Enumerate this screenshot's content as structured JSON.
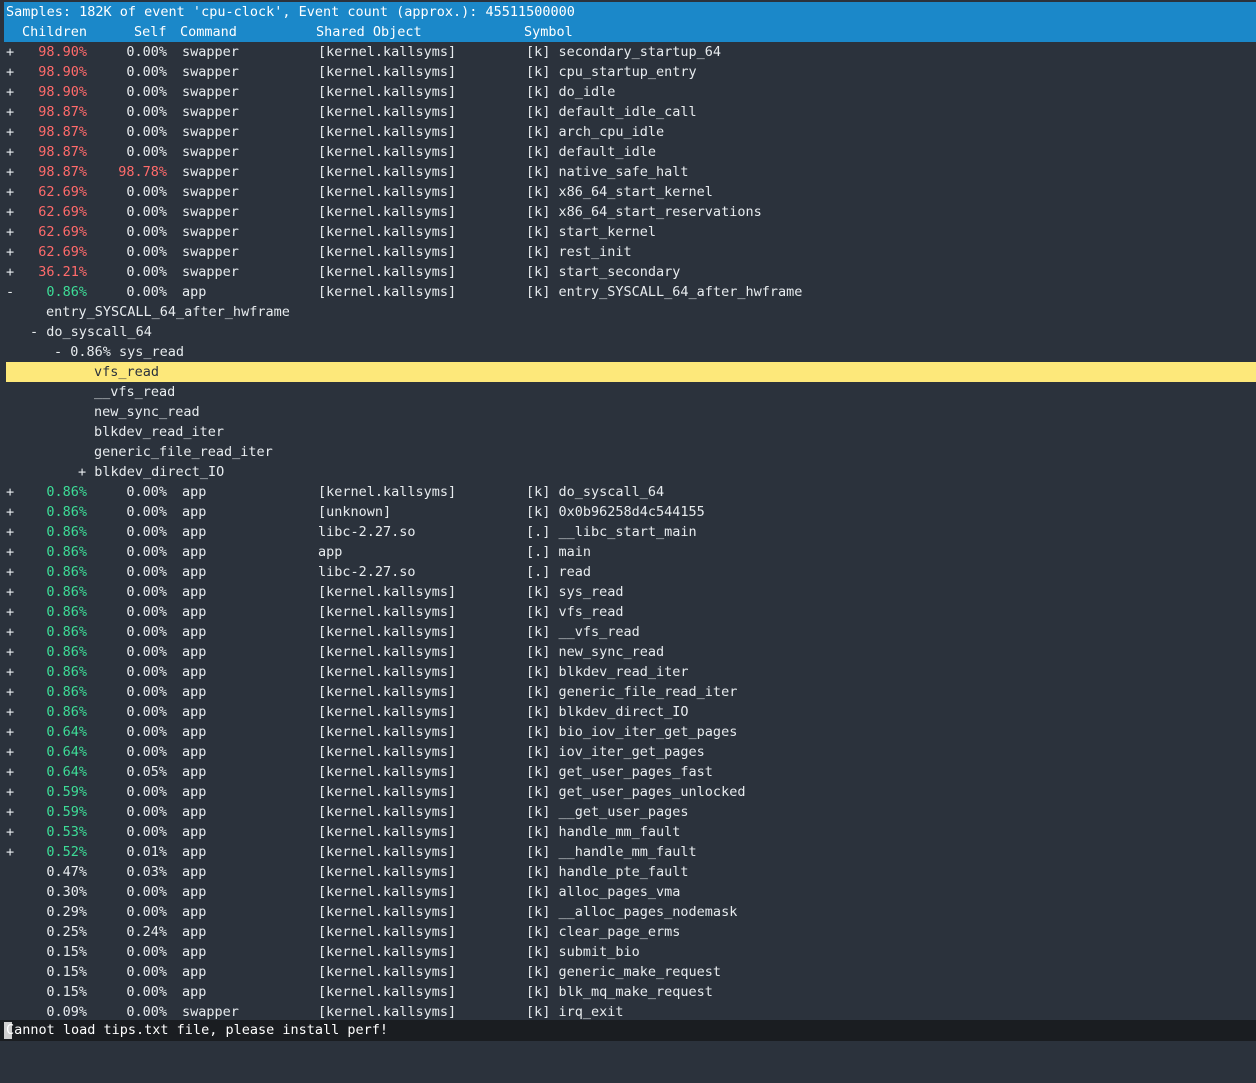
{
  "title": "Samples: 182K of event 'cpu-clock', Event count (approx.): 45511500000",
  "columns": {
    "children": "Children",
    "self": "Self",
    "command": "Command",
    "shared_object": "Shared Object",
    "symbol": "Symbol"
  },
  "rows_top": [
    {
      "toggle": "+",
      "children": "98.90%",
      "self": "0.00%",
      "command": "swapper",
      "object": "[kernel.kallsyms]",
      "symbol": "[k] secondary_startup_64",
      "heat": "hot",
      "self_heat": "plain"
    },
    {
      "toggle": "+",
      "children": "98.90%",
      "self": "0.00%",
      "command": "swapper",
      "object": "[kernel.kallsyms]",
      "symbol": "[k] cpu_startup_entry",
      "heat": "hot",
      "self_heat": "plain"
    },
    {
      "toggle": "+",
      "children": "98.90%",
      "self": "0.00%",
      "command": "swapper",
      "object": "[kernel.kallsyms]",
      "symbol": "[k] do_idle",
      "heat": "hot",
      "self_heat": "plain"
    },
    {
      "toggle": "+",
      "children": "98.87%",
      "self": "0.00%",
      "command": "swapper",
      "object": "[kernel.kallsyms]",
      "symbol": "[k] default_idle_call",
      "heat": "hot",
      "self_heat": "plain"
    },
    {
      "toggle": "+",
      "children": "98.87%",
      "self": "0.00%",
      "command": "swapper",
      "object": "[kernel.kallsyms]",
      "symbol": "[k] arch_cpu_idle",
      "heat": "hot",
      "self_heat": "plain"
    },
    {
      "toggle": "+",
      "children": "98.87%",
      "self": "0.00%",
      "command": "swapper",
      "object": "[kernel.kallsyms]",
      "symbol": "[k] default_idle",
      "heat": "hot",
      "self_heat": "plain"
    },
    {
      "toggle": "+",
      "children": "98.87%",
      "self": "98.78%",
      "command": "swapper",
      "object": "[kernel.kallsyms]",
      "symbol": "[k] native_safe_halt",
      "heat": "hot",
      "self_heat": "hot"
    },
    {
      "toggle": "+",
      "children": "62.69%",
      "self": "0.00%",
      "command": "swapper",
      "object": "[kernel.kallsyms]",
      "symbol": "[k] x86_64_start_kernel",
      "heat": "hot",
      "self_heat": "plain"
    },
    {
      "toggle": "+",
      "children": "62.69%",
      "self": "0.00%",
      "command": "swapper",
      "object": "[kernel.kallsyms]",
      "symbol": "[k] x86_64_start_reservations",
      "heat": "hot",
      "self_heat": "plain"
    },
    {
      "toggle": "+",
      "children": "62.69%",
      "self": "0.00%",
      "command": "swapper",
      "object": "[kernel.kallsyms]",
      "symbol": "[k] start_kernel",
      "heat": "hot",
      "self_heat": "plain"
    },
    {
      "toggle": "+",
      "children": "62.69%",
      "self": "0.00%",
      "command": "swapper",
      "object": "[kernel.kallsyms]",
      "symbol": "[k] rest_init",
      "heat": "hot",
      "self_heat": "plain"
    },
    {
      "toggle": "+",
      "children": "36.21%",
      "self": "0.00%",
      "command": "swapper",
      "object": "[kernel.kallsyms]",
      "symbol": "[k] start_secondary",
      "heat": "hot",
      "self_heat": "plain"
    },
    {
      "toggle": "-",
      "children": "0.86%",
      "self": "0.00%",
      "command": "app",
      "object": "[kernel.kallsyms]",
      "symbol": "[k] entry_SYSCALL_64_after_hwframe",
      "heat": "warm",
      "self_heat": "plain"
    }
  ],
  "tree": [
    {
      "text": "entry_SYSCALL_64_after_hwframe",
      "indent": 46,
      "selected": false
    },
    {
      "text": "- do_syscall_64",
      "indent": 30,
      "selected": false
    },
    {
      "text": "- 0.86% sys_read",
      "indent": 54,
      "selected": false
    },
    {
      "text": "vfs_read",
      "indent": 94,
      "selected": true
    },
    {
      "text": "__vfs_read",
      "indent": 94,
      "selected": false
    },
    {
      "text": "new_sync_read",
      "indent": 94,
      "selected": false
    },
    {
      "text": "blkdev_read_iter",
      "indent": 94,
      "selected": false
    },
    {
      "text": "generic_file_read_iter",
      "indent": 94,
      "selected": false
    },
    {
      "text": "+ blkdev_direct_IO",
      "indent": 78,
      "selected": false
    }
  ],
  "rows_bottom": [
    {
      "toggle": "+",
      "children": "0.86%",
      "self": "0.00%",
      "command": "app",
      "object": "[kernel.kallsyms]",
      "symbol": "[k] do_syscall_64",
      "heat": "warm",
      "self_heat": "plain"
    },
    {
      "toggle": "+",
      "children": "0.86%",
      "self": "0.00%",
      "command": "app",
      "object": "[unknown]",
      "symbol": "[k] 0x0b96258d4c544155",
      "heat": "warm",
      "self_heat": "plain"
    },
    {
      "toggle": "+",
      "children": "0.86%",
      "self": "0.00%",
      "command": "app",
      "object": "libc-2.27.so",
      "symbol": "[.] __libc_start_main",
      "heat": "warm",
      "self_heat": "plain"
    },
    {
      "toggle": "+",
      "children": "0.86%",
      "self": "0.00%",
      "command": "app",
      "object": "app",
      "symbol": "[.] main",
      "heat": "warm",
      "self_heat": "plain"
    },
    {
      "toggle": "+",
      "children": "0.86%",
      "self": "0.00%",
      "command": "app",
      "object": "libc-2.27.so",
      "symbol": "[.] read",
      "heat": "warm",
      "self_heat": "plain"
    },
    {
      "toggle": "+",
      "children": "0.86%",
      "self": "0.00%",
      "command": "app",
      "object": "[kernel.kallsyms]",
      "symbol": "[k] sys_read",
      "heat": "warm",
      "self_heat": "plain"
    },
    {
      "toggle": "+",
      "children": "0.86%",
      "self": "0.00%",
      "command": "app",
      "object": "[kernel.kallsyms]",
      "symbol": "[k] vfs_read",
      "heat": "warm",
      "self_heat": "plain"
    },
    {
      "toggle": "+",
      "children": "0.86%",
      "self": "0.00%",
      "command": "app",
      "object": "[kernel.kallsyms]",
      "symbol": "[k] __vfs_read",
      "heat": "warm",
      "self_heat": "plain"
    },
    {
      "toggle": "+",
      "children": "0.86%",
      "self": "0.00%",
      "command": "app",
      "object": "[kernel.kallsyms]",
      "symbol": "[k] new_sync_read",
      "heat": "warm",
      "self_heat": "plain"
    },
    {
      "toggle": "+",
      "children": "0.86%",
      "self": "0.00%",
      "command": "app",
      "object": "[kernel.kallsyms]",
      "symbol": "[k] blkdev_read_iter",
      "heat": "warm",
      "self_heat": "plain"
    },
    {
      "toggle": "+",
      "children": "0.86%",
      "self": "0.00%",
      "command": "app",
      "object": "[kernel.kallsyms]",
      "symbol": "[k] generic_file_read_iter",
      "heat": "warm",
      "self_heat": "plain"
    },
    {
      "toggle": "+",
      "children": "0.86%",
      "self": "0.00%",
      "command": "app",
      "object": "[kernel.kallsyms]",
      "symbol": "[k] blkdev_direct_IO",
      "heat": "warm",
      "self_heat": "plain"
    },
    {
      "toggle": "+",
      "children": "0.64%",
      "self": "0.00%",
      "command": "app",
      "object": "[kernel.kallsyms]",
      "symbol": "[k] bio_iov_iter_get_pages",
      "heat": "warm",
      "self_heat": "plain"
    },
    {
      "toggle": "+",
      "children": "0.64%",
      "self": "0.00%",
      "command": "app",
      "object": "[kernel.kallsyms]",
      "symbol": "[k] iov_iter_get_pages",
      "heat": "warm",
      "self_heat": "plain"
    },
    {
      "toggle": "+",
      "children": "0.64%",
      "self": "0.05%",
      "command": "app",
      "object": "[kernel.kallsyms]",
      "symbol": "[k] get_user_pages_fast",
      "heat": "warm",
      "self_heat": "plain"
    },
    {
      "toggle": "+",
      "children": "0.59%",
      "self": "0.00%",
      "command": "app",
      "object": "[kernel.kallsyms]",
      "symbol": "[k] get_user_pages_unlocked",
      "heat": "warm",
      "self_heat": "plain"
    },
    {
      "toggle": "+",
      "children": "0.59%",
      "self": "0.00%",
      "command": "app",
      "object": "[kernel.kallsyms]",
      "symbol": "[k] __get_user_pages",
      "heat": "warm",
      "self_heat": "plain"
    },
    {
      "toggle": "+",
      "children": "0.53%",
      "self": "0.00%",
      "command": "app",
      "object": "[kernel.kallsyms]",
      "symbol": "[k] handle_mm_fault",
      "heat": "warm",
      "self_heat": "plain"
    },
    {
      "toggle": "+",
      "children": "0.52%",
      "self": "0.01%",
      "command": "app",
      "object": "[kernel.kallsyms]",
      "symbol": "[k] __handle_mm_fault",
      "heat": "warm",
      "self_heat": "plain"
    },
    {
      "toggle": "",
      "children": "0.47%",
      "self": "0.03%",
      "command": "app",
      "object": "[kernel.kallsyms]",
      "symbol": "[k] handle_pte_fault",
      "heat": "plain",
      "self_heat": "plain"
    },
    {
      "toggle": "",
      "children": "0.30%",
      "self": "0.00%",
      "command": "app",
      "object": "[kernel.kallsyms]",
      "symbol": "[k] alloc_pages_vma",
      "heat": "plain",
      "self_heat": "plain"
    },
    {
      "toggle": "",
      "children": "0.29%",
      "self": "0.00%",
      "command": "app",
      "object": "[kernel.kallsyms]",
      "symbol": "[k] __alloc_pages_nodemask",
      "heat": "plain",
      "self_heat": "plain"
    },
    {
      "toggle": "",
      "children": "0.25%",
      "self": "0.24%",
      "command": "app",
      "object": "[kernel.kallsyms]",
      "symbol": "[k] clear_page_erms",
      "heat": "plain",
      "self_heat": "plain"
    },
    {
      "toggle": "",
      "children": "0.15%",
      "self": "0.00%",
      "command": "app",
      "object": "[kernel.kallsyms]",
      "symbol": "[k] submit_bio",
      "heat": "plain",
      "self_heat": "plain"
    },
    {
      "toggle": "",
      "children": "0.15%",
      "self": "0.00%",
      "command": "app",
      "object": "[kernel.kallsyms]",
      "symbol": "[k] generic_make_request",
      "heat": "plain",
      "self_heat": "plain"
    },
    {
      "toggle": "",
      "children": "0.15%",
      "self": "0.00%",
      "command": "app",
      "object": "[kernel.kallsyms]",
      "symbol": "[k] blk_mq_make_request",
      "heat": "plain",
      "self_heat": "plain"
    },
    {
      "toggle": "",
      "children": "0.09%",
      "self": "0.00%",
      "command": "swapper",
      "object": "[kernel.kallsyms]",
      "symbol": "[k] irq_exit",
      "heat": "plain",
      "self_heat": "plain"
    }
  ],
  "status": "Cannot load tips.txt file, please install perf!",
  "colors": {
    "background": "#2b323c",
    "header": "#1b88c9",
    "hot": "#ff6b6b",
    "warm": "#3ddc97",
    "selection": "#fde87a"
  }
}
